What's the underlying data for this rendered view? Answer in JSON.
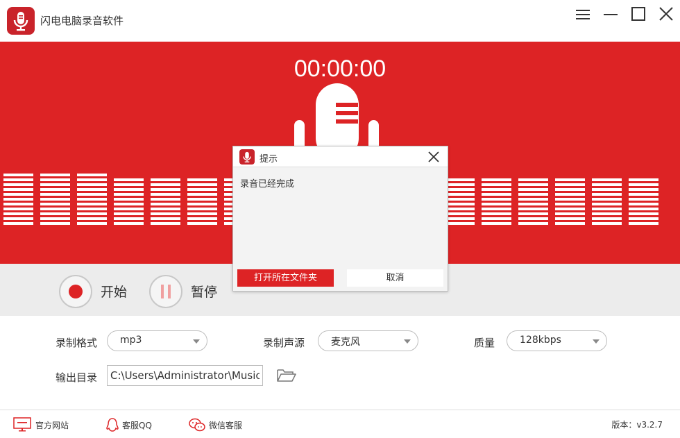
{
  "app": {
    "title": "闪电电脑录音软件",
    "logo_icon": "microphone-icon",
    "brand_color": "#dd2325"
  },
  "window_controls": [
    {
      "name": "menu",
      "icon": "hamburger-menu-icon"
    },
    {
      "name": "minimize",
      "icon": "minimize-icon"
    },
    {
      "name": "maximize",
      "icon": "maximize-icon"
    },
    {
      "name": "close",
      "icon": "close-icon"
    }
  ],
  "recorder": {
    "timer": "00:00:00",
    "start_label": "开始",
    "pause_label": "暂停"
  },
  "settings": {
    "format_label": "录制格式",
    "format_value": "mp3",
    "source_label": "录制声源",
    "source_value": "麦克风",
    "quality_label": "质量",
    "quality_value": "128kbps",
    "output_label": "输出目录",
    "output_path": "C:\\Users\\Administrator\\Music"
  },
  "footer": {
    "website_label": "官方网站",
    "qq_label": "客服QQ",
    "wechat_label": "微信客服",
    "version": "版本：v3.2.7"
  },
  "dialog": {
    "title": "提示",
    "message": "录音已经完成",
    "open_folder_label": "打开所在文件夹",
    "cancel_label": "取消"
  }
}
